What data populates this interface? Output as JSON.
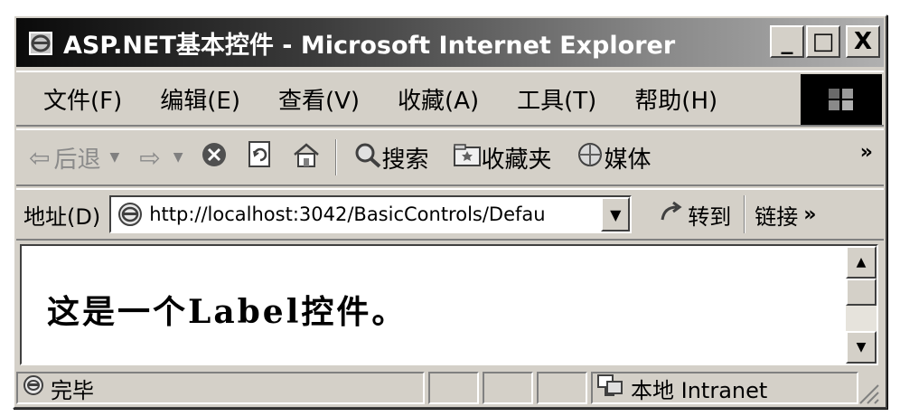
{
  "window": {
    "title": "ASP.NET基本控件 - Microsoft Internet Explorer",
    "buttons": {
      "minimize": "_",
      "maximize": "□",
      "close": "X"
    }
  },
  "menu": {
    "items": [
      "文件(F)",
      "编辑(E)",
      "查看(V)",
      "收藏(A)",
      "工具(T)",
      "帮助(H)"
    ]
  },
  "toolbar": {
    "back": "后退",
    "search": "搜索",
    "favorites": "收藏夹",
    "media": "媒体",
    "more": "»"
  },
  "address": {
    "label": "地址(D)",
    "url": "http://localhost:3042/BasicControls/Defau",
    "go": "转到",
    "links": "链接",
    "links_more": "»"
  },
  "content": {
    "label_text": "这是一个Label控件。"
  },
  "status": {
    "text": "完毕",
    "zone": "本地 Intranet"
  },
  "colors": {
    "chrome": "#d4d0c8",
    "title_dark": "#0a0a0a",
    "title_light": "#b0b0b0"
  }
}
